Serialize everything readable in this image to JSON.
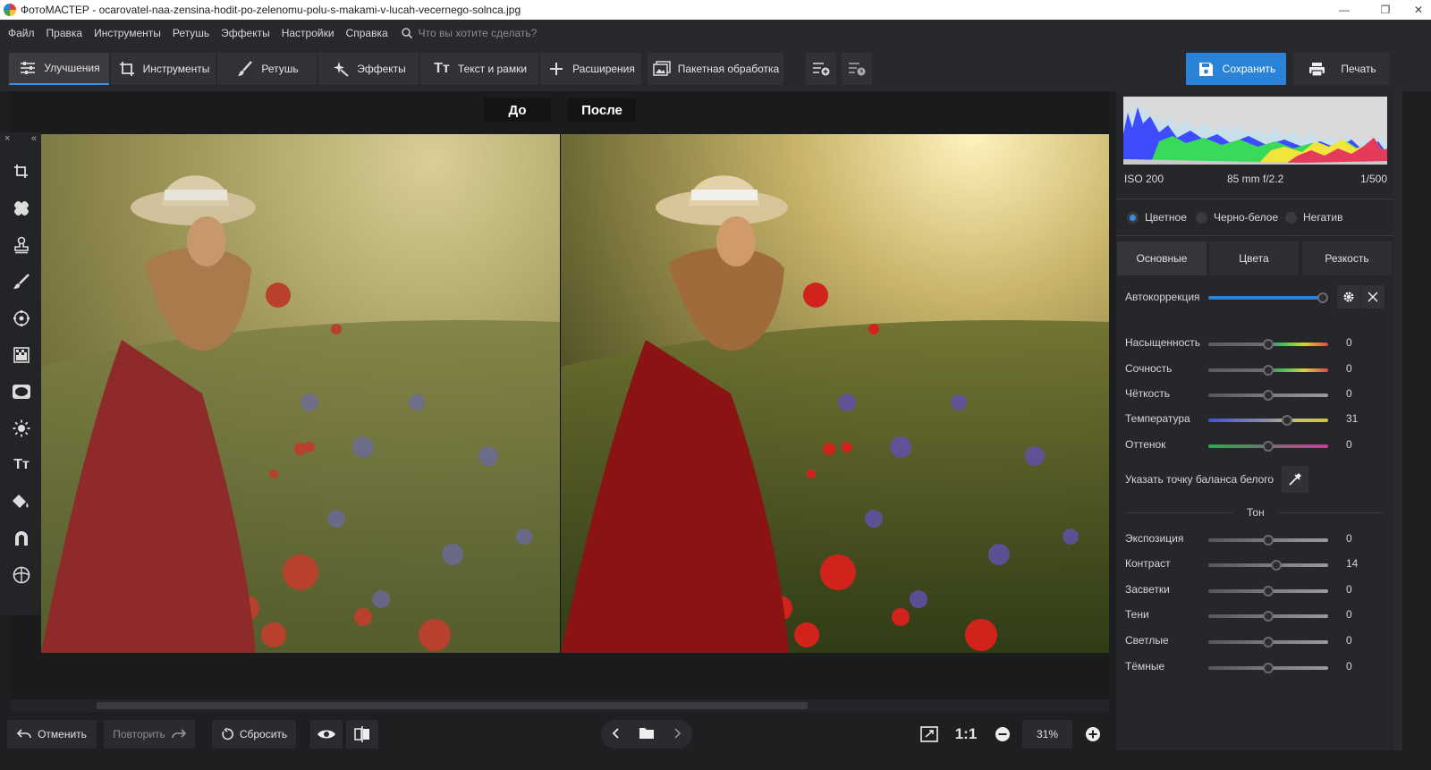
{
  "window": {
    "title": "ФотоМАСТЕР - ocarovatel-naa-zensina-hodit-po-zelenomu-polu-s-makami-v-lucah-vecernego-solnca.jpg",
    "controls": [
      "—",
      "❐",
      "✕"
    ]
  },
  "menu": {
    "items": [
      "Файл",
      "Правка",
      "Инструменты",
      "Ретушь",
      "Эффекты",
      "Настройки",
      "Справка"
    ],
    "search_placeholder": "Что вы хотите сделать?"
  },
  "toolbar": {
    "tabs": [
      {
        "label": "Улучшения",
        "icon": "sliders-icon",
        "active": true
      },
      {
        "label": "Инструменты",
        "icon": "crop-icon",
        "active": false
      },
      {
        "label": "Ретушь",
        "icon": "brush-icon",
        "active": false
      },
      {
        "label": "Эффекты",
        "icon": "sparkle-icon",
        "active": false
      },
      {
        "label": "Текст и рамки",
        "icon": "text-icon",
        "active": false
      },
      {
        "label": "Расширения",
        "icon": "plus-icon",
        "active": false
      },
      {
        "label": "Пакетная обработка",
        "icon": "batch-icon",
        "active": false
      }
    ],
    "save_label": "Сохранить",
    "print_label": "Печать"
  },
  "compare": {
    "before_label": "До",
    "after_label": "После"
  },
  "bottom": {
    "undo_label": "Отменить",
    "redo_label": "Повторить",
    "reset_label": "Сбросить",
    "zoom_1to1": "1:1",
    "zoom_value": "31%"
  },
  "panel": {
    "exif": {
      "iso": "ISO 200",
      "lens": "85 mm f/2.2",
      "shutter": "1/500"
    },
    "modes": [
      {
        "label": "Цветное",
        "selected": true
      },
      {
        "label": "Черно-белое",
        "selected": false
      },
      {
        "label": "Негатив",
        "selected": false
      }
    ],
    "tabs": [
      "Основные",
      "Цвета",
      "Резкость"
    ],
    "autocorrection_label": "Автокоррекция",
    "autocorrection_level": 1.0,
    "sliders_main": [
      {
        "label": "Насыщенность",
        "value": "0",
        "level": 0.5
      },
      {
        "label": "Сочность",
        "value": "0",
        "level": 0.5
      },
      {
        "label": "Чёткость",
        "value": "0",
        "level": 0.5
      },
      {
        "label": "Температура",
        "value": "31",
        "level": 0.655
      },
      {
        "label": "Оттенок",
        "value": "0",
        "level": 0.5
      }
    ],
    "white_balance_label": "Указать точку баланса белого",
    "tone_heading": "Тон",
    "sliders_tone": [
      {
        "label": "Экспозиция",
        "value": "0",
        "level": 0.5
      },
      {
        "label": "Контраст",
        "value": "14",
        "level": 0.57
      },
      {
        "label": "Засветки",
        "value": "0",
        "level": 0.5
      },
      {
        "label": "Тени",
        "value": "0",
        "level": 0.5
      },
      {
        "label": "Светлые",
        "value": "0",
        "level": 0.5
      },
      {
        "label": "Тёмные",
        "value": "0",
        "level": 0.5
      }
    ]
  },
  "colors": {
    "accent": "#2a82d9",
    "panel_bg": "#26272a",
    "toolbar_bg": "#28292c"
  }
}
